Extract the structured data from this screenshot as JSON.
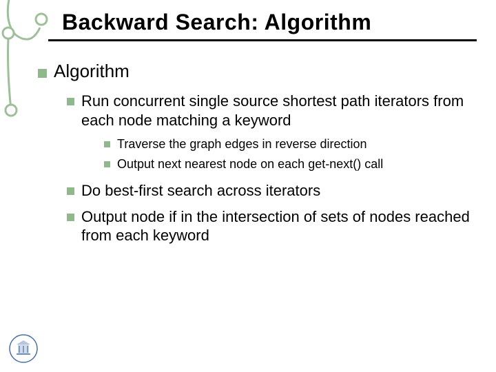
{
  "title": "Backward Search: Algorithm",
  "lvl1": {
    "text": "Algorithm"
  },
  "lvl2": [
    {
      "prefix": "Run ",
      "em": "concurrent",
      "suffix": " single source shortest path iterators from each node matching a keyword"
    },
    {
      "text": "Do best-first search across iterators"
    },
    {
      "text": "Output node if in the intersection of sets of nodes reached from each keyword"
    }
  ],
  "lvl3": [
    {
      "text": "Traverse the graph edges in reverse direction"
    },
    {
      "text": "Output next nearest node on each get-next() call"
    }
  ],
  "colors": {
    "bullet": "#8fb98a",
    "decoration_stroke": "#9fbf9a",
    "decoration_fill": "#d8e8d4"
  }
}
